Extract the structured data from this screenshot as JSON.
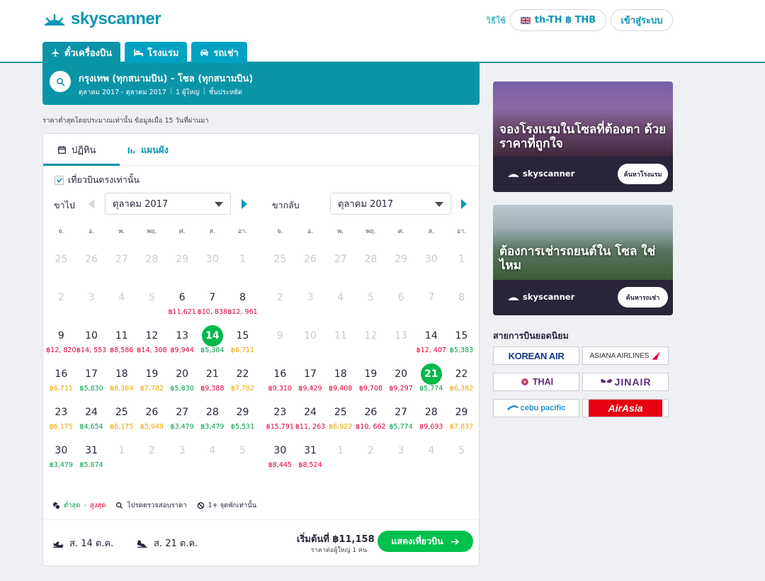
{
  "header": {
    "logo_text": "skyscanner",
    "help": "วิธีใช้",
    "locale": "th-TH ฿ THB",
    "login": "เข้าสู่ระบบ"
  },
  "tabs": [
    {
      "label": "ตั๋วเครื่องบิน",
      "icon": "plane-icon",
      "active": true
    },
    {
      "label": "โรงแรม",
      "icon": "bed-icon",
      "active": false
    },
    {
      "label": "รถเช่า",
      "icon": "car-icon",
      "active": false
    }
  ],
  "search": {
    "route": "กรุงเทพ (ทุกสนามบิน) - โซล (ทุกสนามบิน)",
    "dates": "ตุลาคม 2017 - ตุลาคม 2017",
    "passengers": "1 ผู้ใหญ่",
    "cabin": "ชั้นประหยัด"
  },
  "disclaimer": "ราคาต่ำสุดโดยประมาณเท่านั้น ข้อมูลเมื่อ 15 วันที่ผ่านมา",
  "view_tabs": {
    "calendar": "ปฏิทิน",
    "chart": "แผนผัง"
  },
  "direct_only": "เที่ยวบินตรงเท่านั้น",
  "weekdays": [
    "จ.",
    "อ.",
    "พ.",
    "พฤ.",
    "ศ.",
    "ส.",
    "อา."
  ],
  "outbound": {
    "label": "ขาไป",
    "month": "ตุลาคม 2017",
    "days": [
      {
        "d": "25",
        "muted": true
      },
      {
        "d": "26",
        "muted": true
      },
      {
        "d": "27",
        "muted": true
      },
      {
        "d": "28",
        "muted": true
      },
      {
        "d": "29",
        "muted": true
      },
      {
        "d": "30",
        "muted": true
      },
      {
        "d": "1",
        "muted": true
      },
      {
        "d": "2",
        "muted": true
      },
      {
        "d": "3",
        "muted": true
      },
      {
        "d": "4",
        "muted": true
      },
      {
        "d": "5",
        "muted": true
      },
      {
        "d": "6",
        "price": "฿11,621",
        "c": "red"
      },
      {
        "d": "7",
        "price": "฿10, 838",
        "c": "red"
      },
      {
        "d": "8",
        "price": "฿12, 961",
        "c": "red"
      },
      {
        "d": "9",
        "price": "฿12, 820",
        "c": "red"
      },
      {
        "d": "10",
        "price": "฿14, 553",
        "c": "red"
      },
      {
        "d": "11",
        "price": "฿8,586",
        "c": "red"
      },
      {
        "d": "12",
        "price": "฿14, 308",
        "c": "red"
      },
      {
        "d": "13",
        "price": "฿9,944",
        "c": "red"
      },
      {
        "d": "14",
        "price": "฿5,384",
        "c": "green",
        "selected": true
      },
      {
        "d": "15",
        "price": "฿6,711",
        "c": "orange"
      },
      {
        "d": "16",
        "price": "฿6,711",
        "c": "orange"
      },
      {
        "d": "17",
        "price": "฿5,830",
        "c": "green"
      },
      {
        "d": "18",
        "price": "฿8,384",
        "c": "orange"
      },
      {
        "d": "19",
        "price": "฿7,782",
        "c": "orange"
      },
      {
        "d": "20",
        "price": "฿5,830",
        "c": "green"
      },
      {
        "d": "21",
        "price": "฿9,388",
        "c": "red"
      },
      {
        "d": "22",
        "price": "฿7,782",
        "c": "orange"
      },
      {
        "d": "23",
        "price": "฿6,175",
        "c": "orange"
      },
      {
        "d": "24",
        "price": "฿4,654",
        "c": "green"
      },
      {
        "d": "25",
        "price": "฿6,175",
        "c": "orange"
      },
      {
        "d": "26",
        "price": "฿5,949",
        "c": "orange"
      },
      {
        "d": "27",
        "price": "฿3,479",
        "c": "green"
      },
      {
        "d": "28",
        "price": "฿3,479",
        "c": "green"
      },
      {
        "d": "29",
        "price": "฿5,531",
        "c": "green"
      },
      {
        "d": "30",
        "price": "฿3,479",
        "c": "green"
      },
      {
        "d": "31",
        "price": "฿5,874",
        "c": "green"
      },
      {
        "d": "1",
        "muted": true
      },
      {
        "d": "2",
        "muted": true
      },
      {
        "d": "3",
        "muted": true
      },
      {
        "d": "4",
        "muted": true
      },
      {
        "d": "5",
        "muted": true
      }
    ]
  },
  "inbound": {
    "label": "ขากลับ",
    "month": "ตุลาคม 2017",
    "days": [
      {
        "d": "25",
        "muted": true
      },
      {
        "d": "26",
        "muted": true
      },
      {
        "d": "27",
        "muted": true
      },
      {
        "d": "28",
        "muted": true
      },
      {
        "d": "29",
        "muted": true
      },
      {
        "d": "30",
        "muted": true
      },
      {
        "d": "1",
        "muted": true
      },
      {
        "d": "2",
        "muted": true
      },
      {
        "d": "3",
        "muted": true
      },
      {
        "d": "4",
        "muted": true
      },
      {
        "d": "5",
        "muted": true
      },
      {
        "d": "6",
        "muted": true
      },
      {
        "d": "7",
        "muted": true
      },
      {
        "d": "8",
        "muted": true
      },
      {
        "d": "9",
        "muted": true
      },
      {
        "d": "10",
        "muted": true
      },
      {
        "d": "11",
        "muted": true
      },
      {
        "d": "12",
        "muted": true
      },
      {
        "d": "13",
        "muted": true
      },
      {
        "d": "14",
        "price": "฿12, 407",
        "c": "red"
      },
      {
        "d": "15",
        "price": "฿5,383",
        "c": "green"
      },
      {
        "d": "16",
        "price": "฿9,310",
        "c": "red"
      },
      {
        "d": "17",
        "price": "฿9,429",
        "c": "red"
      },
      {
        "d": "18",
        "price": "฿9,408",
        "c": "red"
      },
      {
        "d": "19",
        "price": "฿9,708",
        "c": "red"
      },
      {
        "d": "20",
        "price": "฿9,297",
        "c": "red"
      },
      {
        "d": "21",
        "price": "฿5,774",
        "c": "green",
        "selected": true
      },
      {
        "d": "22",
        "price": "฿6,382",
        "c": "orange"
      },
      {
        "d": "23",
        "price": "฿15,791",
        "c": "red"
      },
      {
        "d": "24",
        "price": "฿11, 263",
        "c": "red"
      },
      {
        "d": "25",
        "price": "฿6,922",
        "c": "orange"
      },
      {
        "d": "26",
        "price": "฿10, 662",
        "c": "red"
      },
      {
        "d": "27",
        "price": "฿5,774",
        "c": "green"
      },
      {
        "d": "28",
        "price": "฿9,693",
        "c": "red"
      },
      {
        "d": "29",
        "price": "฿7,837",
        "c": "orange"
      },
      {
        "d": "30",
        "price": "฿8,445",
        "c": "red"
      },
      {
        "d": "31",
        "price": "฿8,524",
        "c": "red"
      },
      {
        "d": "1",
        "muted": true
      },
      {
        "d": "2",
        "muted": true
      },
      {
        "d": "3",
        "muted": true
      },
      {
        "d": "4",
        "muted": true
      },
      {
        "d": "5",
        "muted": true
      }
    ]
  },
  "legend": {
    "low": "ต่ำสุด",
    "dash": " - ",
    "high": "สูงสุด",
    "check": "โปรดตรวจสอบราคา",
    "stops": "1+ จุดพักเท่านั้น"
  },
  "footer": {
    "depart": "ส. 14 ต.ค.",
    "return": "ส. 21 ต.ค.",
    "from_price": "เริ่มต้นที่ ฿11,158",
    "per_person": "ราคาต่อผู้ใหญ่ 1 คน",
    "show_button": "แสดงเที่ยวบิน"
  },
  "ads": [
    {
      "title": "จองโรงแรมในโซลที่ต้องตา ด้วยราคาที่ถูกใจ",
      "logo": "skyscanner",
      "button": "ค้นหาโรงแรม"
    },
    {
      "title": "ต้องการเช่ารถยนต์ใน โซล ใช่ไหม",
      "logo": "skyscanner",
      "button": "ค้นหารถเช่า"
    }
  ],
  "popular": {
    "title": "สายการบินยอดนิยม",
    "airlines": [
      "KOREAN AIR",
      "ASIANA AIRLINES",
      "THAI",
      "JINAIR",
      "cebu pacific",
      "AirAsia"
    ]
  },
  "colors": {
    "brand": "#0a94a8",
    "cheap": "#00a04b",
    "mid": "#f0a500",
    "expensive": "#e4003a",
    "cta": "#00c14e"
  }
}
